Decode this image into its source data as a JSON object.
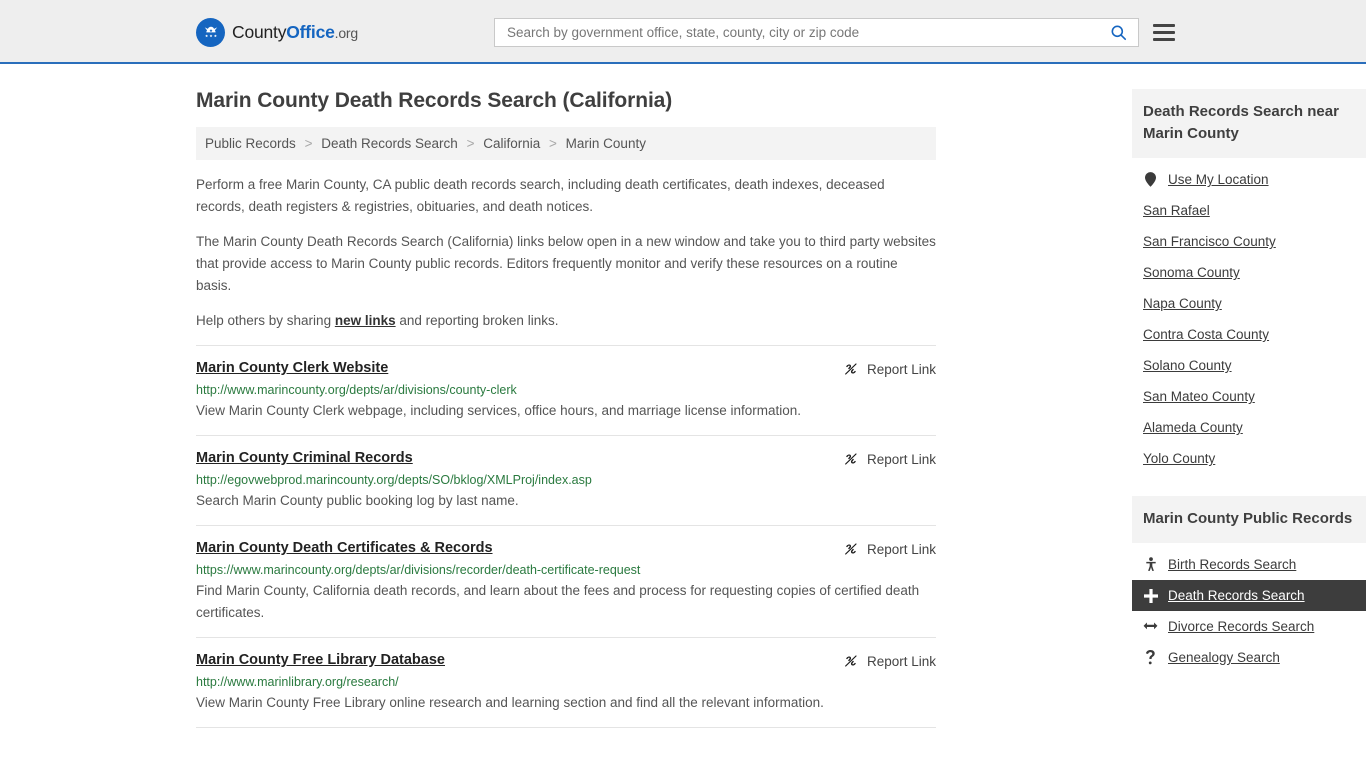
{
  "header": {
    "logo": {
      "part1": "County",
      "part2": "Office",
      "part3": ".org",
      "icon": "eagle-stars-seal-icon",
      "color": "#1565c0"
    },
    "search": {
      "placeholder": "Search by government office, state, county, city or zip code",
      "value": "",
      "button_icon": "search-icon",
      "button_color": "#1565c0"
    },
    "menu_icon": "hamburger-menu-icon",
    "background": "#eeeeee",
    "border_color": "#2a6ebb"
  },
  "main": {
    "title": "Marin County Death Records Search (California)",
    "breadcrumb": [
      "Public Records",
      "Death Records Search",
      "California",
      "Marin County"
    ],
    "breadcrumb_separator": ">",
    "intro": {
      "p1": "Perform a free Marin County, CA public death records search, including death certificates, death indexes, deceased records, death registers & registries, obituaries, and death notices.",
      "p2": "The Marin County Death Records Search (California) links below open in a new window and take you to third party websites that provide access to Marin County public records. Editors frequently monitor and verify these resources on a routine basis.",
      "p3_before": "Help others by sharing ",
      "p3_link": "new links",
      "p3_after": " and reporting broken links."
    },
    "report_label": "Report Link",
    "report_icon": "broken-link-icon",
    "results": [
      {
        "title": "Marin County Clerk Website",
        "url": "http://www.marincounty.org/depts/ar/divisions/county-clerk",
        "description": "View Marin County Clerk webpage, including services, office hours, and marriage license information."
      },
      {
        "title": "Marin County Criminal Records",
        "url": "http://egovwebprod.marincounty.org/depts/SO/bklog/XMLProj/index.asp",
        "description": "Search Marin County public booking log by last name."
      },
      {
        "title": "Marin County Death Certificates & Records",
        "url": "https://www.marincounty.org/depts/ar/divisions/recorder/death-certificate-request",
        "description": "Find Marin County, California death records, and learn about the fees and process for requesting copies of certified death certificates."
      },
      {
        "title": "Marin County Free Library Database",
        "url": "http://www.marinlibrary.org/research/",
        "description": "View Marin County Free Library online research and learning section and find all the relevant information."
      }
    ]
  },
  "sidebar": {
    "near_header": "Death Records Search near Marin County",
    "use_my_location": {
      "label": "Use My Location",
      "icon": "map-pin-icon"
    },
    "nearby": [
      "San Rafael",
      "San Francisco County",
      "Sonoma County",
      "Napa County",
      "Contra Costa County",
      "Solano County",
      "San Mateo County",
      "Alameda County",
      "Yolo County"
    ],
    "public_records_header": "Marin County Public Records",
    "public_records": [
      {
        "label": "Birth Records Search",
        "icon": "baby-icon",
        "active": false
      },
      {
        "label": "Death Records Search",
        "icon": "plus-cross-icon",
        "active": true
      },
      {
        "label": "Divorce Records Search",
        "icon": "left-right-arrow-icon",
        "active": false
      },
      {
        "label": "Genealogy Search",
        "icon": "question-mark-icon",
        "active": false
      }
    ],
    "active_background": "#3d3d3d"
  }
}
